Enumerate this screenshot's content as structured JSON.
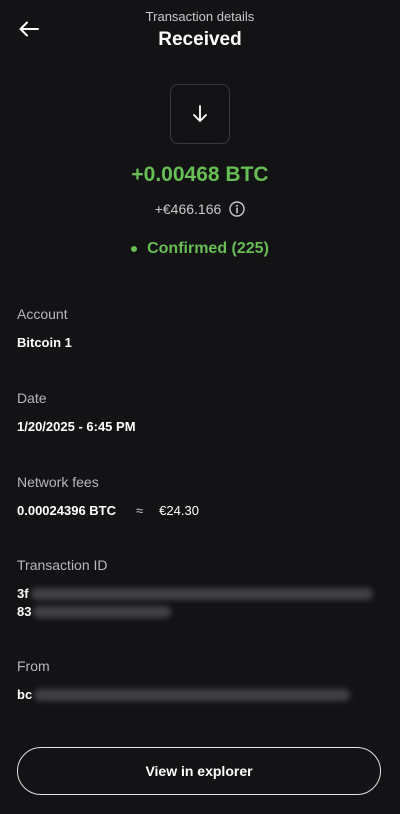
{
  "header": {
    "subtitle": "Transaction details",
    "title": "Received",
    "back_icon": "arrow-left-icon"
  },
  "transaction": {
    "direction_icon": "arrow-down-icon",
    "amount": "+0.00468 BTC",
    "fiat_amount": "+€466.166",
    "status": "Confirmed (225)"
  },
  "fields": {
    "account": {
      "label": "Account",
      "value": "Bitcoin 1"
    },
    "date": {
      "label": "Date",
      "value": "1/20/2025 - 6:45 PM"
    },
    "network_fees": {
      "label": "Network fees",
      "crypto": "0.00024396 BTC",
      "approx": "≈",
      "fiat": "€24.30"
    },
    "transaction_id": {
      "label": "Transaction ID",
      "line1_visible": "3f",
      "line2_visible": "83"
    },
    "from": {
      "label": "From",
      "visible": "bc"
    }
  },
  "actions": {
    "explorer_label": "View in explorer"
  },
  "colors": {
    "background": "#131214",
    "accent_green": "#66be54",
    "muted_text": "#b8b8bc"
  }
}
